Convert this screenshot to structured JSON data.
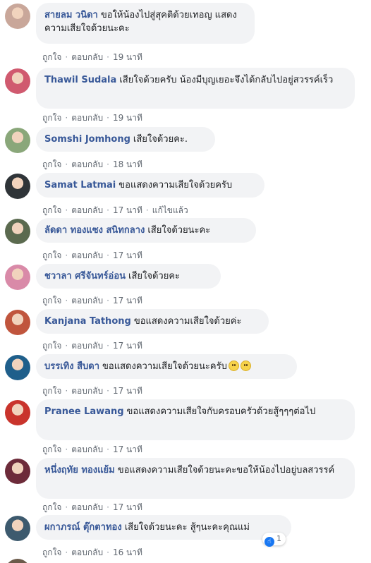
{
  "comments": [
    {
      "name": "สายลม วนิดา",
      "text": "ขอให้น้องไปสู่สุคติด้วยเทอญ แสดงความเสียใจด้วยนะคะ",
      "like": "ถูกใจ",
      "reply": "ตอบกลับ",
      "time": "19 นาที",
      "avatar_color": "#c9a79a"
    },
    {
      "name": "Thawil Sudala",
      "text": "เสียใจด้วยครับ น้องมีบุญเยอะจึงได้กลับไปอยู่สวรรค์เร็ว",
      "like": "ถูกใจ",
      "reply": "ตอบกลับ",
      "time": "19 นาที",
      "avatar_color": "#d05a6f"
    },
    {
      "name": "Somshi Jomhong",
      "text": "เสียใจด้วยคะ.",
      "like": "ถูกใจ",
      "reply": "ตอบกลับ",
      "time": "18 นาที",
      "avatar_color": "#8aa77a"
    },
    {
      "name": "Samat Latmai",
      "text": "ขอแสดงความเสียใจด้วยครับ",
      "like": "ถูกใจ",
      "reply": "ตอบกลับ",
      "time": "17 นาที",
      "edited": "แก้ไขแล้ว",
      "avatar_color": "#2f3438"
    },
    {
      "name": "ลัดดา ทองแซง สนิทกลาง",
      "text": "เสียใจด้วยนะคะ",
      "like": "ถูกใจ",
      "reply": "ตอบกลับ",
      "time": "17 นาที",
      "avatar_color": "#5b6a4f"
    },
    {
      "name": "ชวาลา ศรีจันทร์อ่อน",
      "text": "เสียใจด้วยคะ",
      "like": "ถูกใจ",
      "reply": "ตอบกลับ",
      "time": "17 นาที",
      "avatar_color": "#d98aa8"
    },
    {
      "name": "Kanjana Tathong",
      "text": "ขอแสดงความเสียใจด้วยค่ะ",
      "like": "ถูกใจ",
      "reply": "ตอบกลับ",
      "time": "17 นาที",
      "avatar_color": "#c0553d"
    },
    {
      "name": "บรรเทิง สืบดา",
      "text": "ขอแสดงความเสียใจด้วยนะครับ",
      "like": "ถูกใจ",
      "reply": "ตอบกลับ",
      "time": "17 นาที",
      "emoji": "sad-face-icon",
      "avatar_color": "#1f5f8b"
    },
    {
      "name": "Pranee Lawang",
      "text": "ขอแสดงความเสียใจกับครอบครัวด้วยสู้ๆๆๆต่อไป",
      "like": "ถูกใจ",
      "reply": "ตอบกลับ",
      "time": "17 นาที",
      "avatar_color": "#c9342c"
    },
    {
      "name": "หนึ่งฤทัย ทองแย้ม",
      "text": "ขอแสดงความเสียใจด้วยนะคะขอให้น้องไปอยู่บลสวรรค์",
      "like": "ถูกใจ",
      "reply": "ตอบกลับ",
      "time": "17 นาที",
      "avatar_color": "#6d2b3a"
    },
    {
      "name": "ผกาภรณ์ ตุ๊กตาทอง",
      "text": "เสียใจด้วยนะคะ สู้ๆนะคะคุณแม่",
      "like": "ถูกใจ",
      "reply": "ตอบกลับ",
      "time": "16 นาที",
      "reaction_count": "1",
      "avatar_color": "#3d5a6e"
    }
  ]
}
